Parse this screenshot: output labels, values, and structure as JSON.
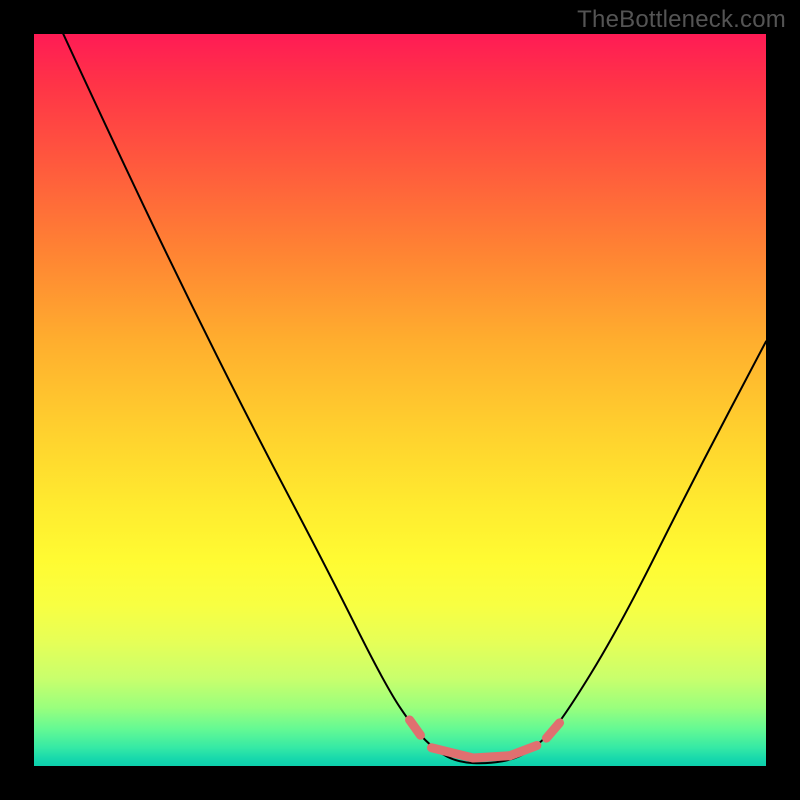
{
  "watermark": "TheBottleneck.com",
  "chart_data": {
    "type": "line",
    "title": "",
    "xlabel": "",
    "ylabel": "",
    "xlim": [
      0,
      100
    ],
    "ylim": [
      0,
      100
    ],
    "grid": false,
    "legend": false,
    "background_gradient": {
      "top": "#ff1b55",
      "mid": "#ffea2f",
      "bottom": "#0ccfac"
    },
    "series": [
      {
        "name": "bottleneck-curve",
        "color": "#000000",
        "stroke_width": 2,
        "points": [
          {
            "x": 4,
            "y": 100
          },
          {
            "x": 10,
            "y": 87
          },
          {
            "x": 20,
            "y": 66
          },
          {
            "x": 30,
            "y": 46
          },
          {
            "x": 40,
            "y": 27
          },
          {
            "x": 48,
            "y": 11
          },
          {
            "x": 52,
            "y": 5
          },
          {
            "x": 55,
            "y": 2
          },
          {
            "x": 58,
            "y": 0.5
          },
          {
            "x": 62,
            "y": 0.3
          },
          {
            "x": 66,
            "y": 1
          },
          {
            "x": 69,
            "y": 3
          },
          {
            "x": 72,
            "y": 6
          },
          {
            "x": 80,
            "y": 19
          },
          {
            "x": 90,
            "y": 39
          },
          {
            "x": 100,
            "y": 58
          }
        ]
      }
    ],
    "markers": {
      "name": "optimal-range",
      "color": "#e07070",
      "stroke_width": 9,
      "segments": [
        [
          {
            "x": 51.3,
            "y": 6.3
          },
          {
            "x": 52.8,
            "y": 4.2
          }
        ],
        [
          {
            "x": 54.3,
            "y": 2.5
          },
          {
            "x": 60.0,
            "y": 1.1
          }
        ],
        [
          {
            "x": 60.0,
            "y": 1.1
          },
          {
            "x": 65.0,
            "y": 1.4
          }
        ],
        [
          {
            "x": 65.0,
            "y": 1.4
          },
          {
            "x": 68.7,
            "y": 2.8
          }
        ],
        [
          {
            "x": 70.0,
            "y": 3.8
          },
          {
            "x": 71.8,
            "y": 5.9
          }
        ]
      ]
    }
  }
}
